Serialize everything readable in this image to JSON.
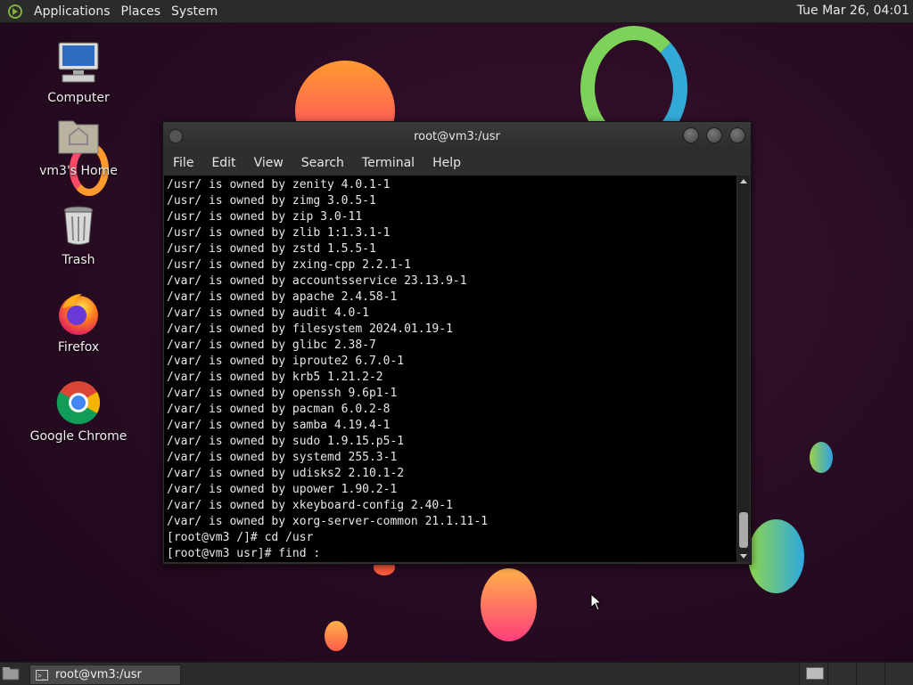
{
  "top_panel": {
    "menus": [
      "Applications",
      "Places",
      "System"
    ],
    "clock": "Tue Mar 26, 04:01"
  },
  "desktop_icons": [
    {
      "label": "Computer",
      "icon": "computer-icon"
    },
    {
      "label": "vm3's Home",
      "icon": "home-folder-icon"
    },
    {
      "label": "Trash",
      "icon": "trash-icon"
    },
    {
      "label": "Firefox",
      "icon": "firefox-icon"
    },
    {
      "label": "Google Chrome",
      "icon": "chrome-icon"
    }
  ],
  "terminal": {
    "title": "root@vm3:/usr",
    "menus": [
      "File",
      "Edit",
      "View",
      "Search",
      "Terminal",
      "Help"
    ],
    "lines": [
      "/usr/ is owned by zenity 4.0.1-1",
      "/usr/ is owned by zimg 3.0.5-1",
      "/usr/ is owned by zip 3.0-11",
      "/usr/ is owned by zlib 1:1.3.1-1",
      "/usr/ is owned by zstd 1.5.5-1",
      "/usr/ is owned by zxing-cpp 2.2.1-1",
      "/var/ is owned by accountsservice 23.13.9-1",
      "/var/ is owned by apache 2.4.58-1",
      "/var/ is owned by audit 4.0-1",
      "/var/ is owned by filesystem 2024.01.19-1",
      "/var/ is owned by glibc 2.38-7",
      "/var/ is owned by iproute2 6.7.0-1",
      "/var/ is owned by krb5 1.21.2-2",
      "/var/ is owned by openssh 9.6p1-1",
      "/var/ is owned by pacman 6.0.2-8",
      "/var/ is owned by samba 4.19.4-1",
      "/var/ is owned by sudo 1.9.15.p5-1",
      "/var/ is owned by systemd 255.3-1",
      "/var/ is owned by udisks2 2.10.1-2",
      "/var/ is owned by upower 1.90.2-1",
      "/var/ is owned by xkeyboard-config 2.40-1",
      "/var/ is owned by xorg-server-common 21.1.11-1",
      "[root@vm3 /]# cd /usr",
      "[root@vm3 usr]# find :"
    ]
  },
  "taskbar": {
    "tasks": [
      {
        "label": "root@vm3:/usr",
        "icon": "terminal-icon"
      }
    ],
    "workspaces": 4,
    "active_workspace": 1
  },
  "colors": {
    "background": "#2a0c24",
    "panel": "#2b2b2b",
    "terminal_bg": "#000000",
    "terminal_fg": "#e8e8e8"
  }
}
